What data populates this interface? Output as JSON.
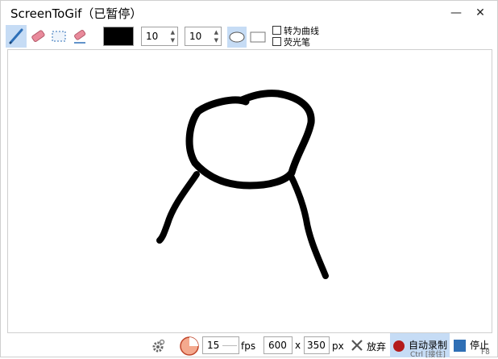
{
  "window": {
    "title": "ScreenToGif（已暂停）"
  },
  "titlebar": {
    "minimize_glyph": "—",
    "close_glyph": "✕"
  },
  "toolbar": {
    "color": "#000000",
    "size1": "10",
    "size2": "10",
    "curve_label": "转为曲线",
    "highlighter_label": "荧光笔"
  },
  "footer": {
    "fps_value": "15",
    "fps_unit": "fps",
    "width_value": "600",
    "times": "x",
    "height_value": "350",
    "px_unit": "px",
    "discard_label": "放弃",
    "record_label": "自动录制",
    "record_shortcut": "Ctrl [接住]",
    "stop_label": "停止",
    "stop_shortcut": "F8"
  }
}
